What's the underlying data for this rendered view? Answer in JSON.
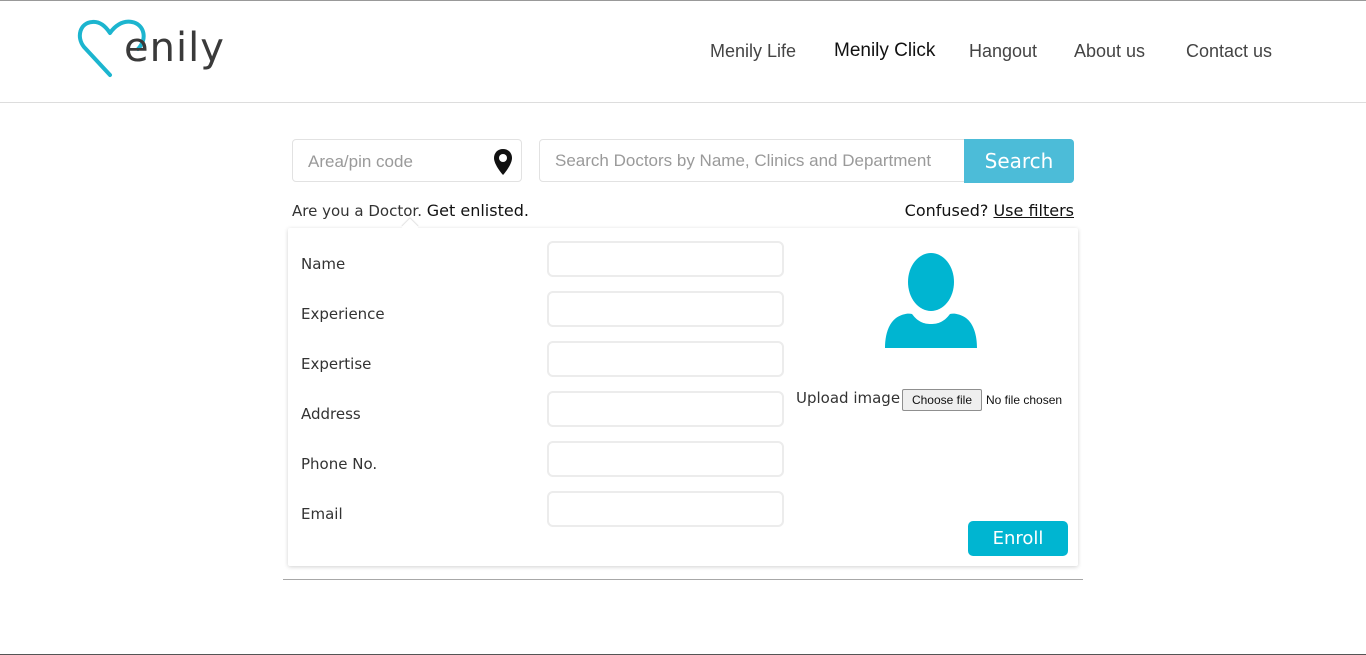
{
  "brand": {
    "logo_text": "enily",
    "accent_color": "#1cb5cf"
  },
  "nav": {
    "items": [
      {
        "label": "Menily Life",
        "active": false
      },
      {
        "label": "Menily Click",
        "active": true
      },
      {
        "label": "Hangout",
        "active": false
      },
      {
        "label": "About us",
        "active": false
      },
      {
        "label": "Contact us",
        "active": false
      }
    ]
  },
  "search": {
    "area_placeholder": "Area/pin code",
    "area_icon": "map-pin-icon",
    "query_placeholder": "Search Doctors by Name, Clinics and Department",
    "button_label": "Search",
    "button_color": "#4cbcd8"
  },
  "doctor_prompt": {
    "question": "Are you a Doctor.",
    "link": "Get enlisted."
  },
  "filters_prompt": {
    "question": "Confused?",
    "link": "Use filters"
  },
  "form": {
    "fields": [
      {
        "label": "Name",
        "value": ""
      },
      {
        "label": "Experience",
        "value": ""
      },
      {
        "label": "Expertise",
        "value": ""
      },
      {
        "label": "Address",
        "value": ""
      },
      {
        "label": "Phone No.",
        "value": ""
      },
      {
        "label": "Email",
        "value": ""
      }
    ],
    "avatar_icon": "user-avatar-icon",
    "upload_label": "Upload image",
    "file_button_label": "Choose file",
    "file_status": "No file chosen",
    "submit_label": "Enroll",
    "submit_color": "#00b5d1"
  }
}
